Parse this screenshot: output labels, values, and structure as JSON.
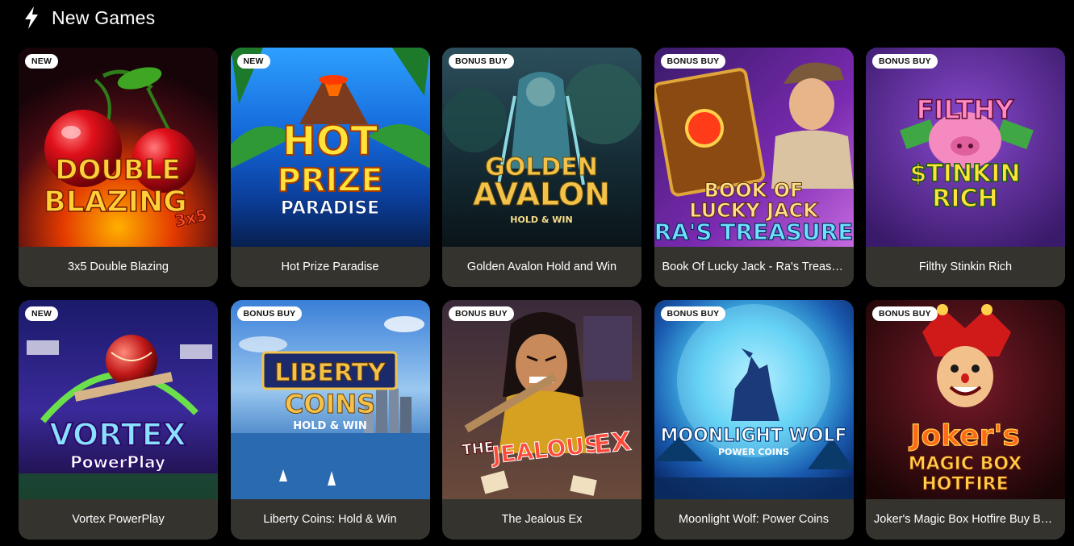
{
  "section": {
    "title": "New Games",
    "icon": "lightning-bolt-icon"
  },
  "games": [
    {
      "title": "3x5 Double Blazing",
      "badge": "NEW",
      "logo": [
        "DOUBLE",
        "BLAZING",
        "3x5"
      ]
    },
    {
      "title": "Hot Prize Paradise",
      "badge": "NEW",
      "logo": [
        "HOT",
        "PRIZE",
        "PARADISE"
      ]
    },
    {
      "title": "Golden Avalon Hold and Win",
      "badge": "BONUS BUY",
      "logo": [
        "GOLDEN",
        "AVALON",
        "HOLD & WIN"
      ]
    },
    {
      "title": "Book Of Lucky Jack - Ra's Treasure",
      "badge": "BONUS BUY",
      "logo": [
        "BOOK OF",
        "LUCKY JACK",
        "RA'S TREASURE"
      ]
    },
    {
      "title": "Filthy Stinkin Rich",
      "badge": "BONUS BUY",
      "logo": [
        "FILTHY",
        "$TINKIN",
        "RICH"
      ]
    },
    {
      "title": "Vortex PowerPlay",
      "badge": "NEW",
      "logo": [
        "VORTEX",
        "PowerPlay"
      ]
    },
    {
      "title": "Liberty Coins: Hold & Win",
      "badge": "BONUS BUY",
      "logo": [
        "LIBERTY",
        "COINS",
        "HOLD & WIN"
      ]
    },
    {
      "title": "The Jealous Ex",
      "badge": "BONUS BUY",
      "logo": [
        "THE",
        "JEALOUS",
        "EX"
      ]
    },
    {
      "title": "Moonlight Wolf: Power Coins",
      "badge": "BONUS BUY",
      "logo": [
        "MOONLIGHT WOLF",
        "POWER COINS"
      ]
    },
    {
      "title": "Joker's Magic Box Hotfire Buy Bonus",
      "badge": "BONUS BUY",
      "logo": [
        "Joker's",
        "MAGIC BOX",
        "HOTFIRE"
      ]
    }
  ]
}
